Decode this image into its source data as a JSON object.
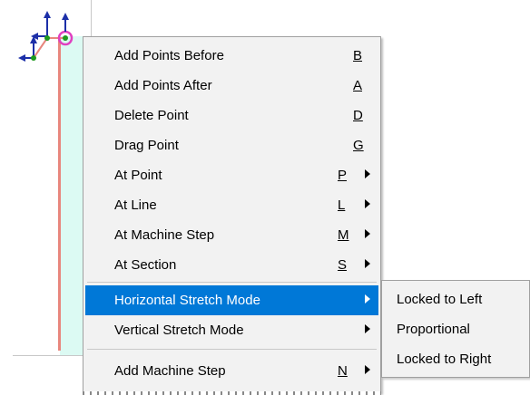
{
  "menu": {
    "items": [
      {
        "label": "Add Points Before",
        "shortcut": "B",
        "submenu": false
      },
      {
        "label": "Add Points After",
        "shortcut": "A",
        "submenu": false
      },
      {
        "label": "Delete Point",
        "shortcut": "D",
        "submenu": false
      },
      {
        "label": "Drag Point",
        "shortcut": "G",
        "submenu": false
      },
      {
        "label": "At Point",
        "shortcut": "P",
        "submenu": true
      },
      {
        "label": "At Line",
        "shortcut": "L",
        "submenu": true
      },
      {
        "label": "At Machine Step",
        "shortcut": "M",
        "submenu": true
      },
      {
        "label": "At Section",
        "shortcut": "S",
        "submenu": true
      },
      {
        "label": "Horizontal Stretch Mode",
        "shortcut": "",
        "submenu": true,
        "highlighted": true
      },
      {
        "label": "Vertical Stretch Mode",
        "shortcut": "",
        "submenu": true
      },
      {
        "label": "Add Machine Step",
        "shortcut": "N",
        "submenu": true
      }
    ]
  },
  "submenu": {
    "items": [
      {
        "label": "Locked to Left"
      },
      {
        "label": "Proportional"
      },
      {
        "label": "Locked to Right"
      }
    ]
  },
  "colors": {
    "highlight": "#0078d7",
    "menu_bg": "#f2f2f2",
    "canvas_fill": "#dcfaf3",
    "profile_line": "#e8867d",
    "gizmo_axis": "#1c2fa8",
    "gizmo_ring": "#e040c0",
    "gizmo_point": "#1e9a1e"
  },
  "icons": {
    "arrow": "submenu-arrow-icon",
    "gizmo": "transform-gizmo-icon"
  }
}
